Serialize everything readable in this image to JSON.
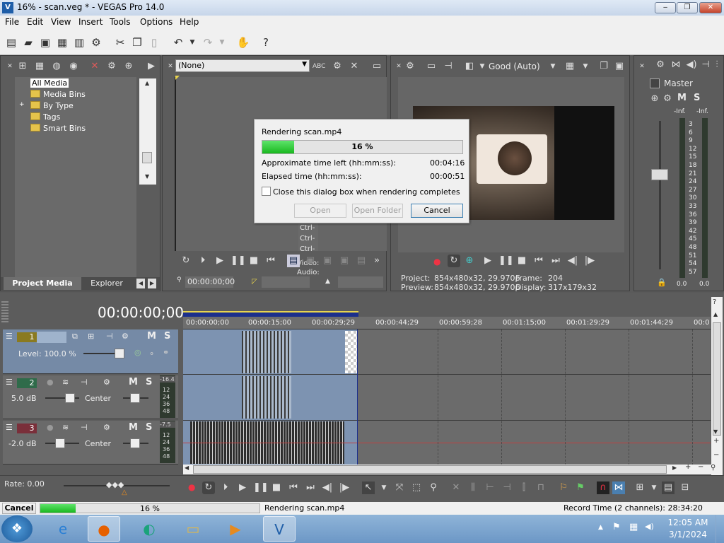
{
  "window": {
    "title": "16% - scan.veg * - VEGAS Pro 14.0",
    "minimize": "‒",
    "maximize": "❐",
    "close": "✕"
  },
  "menu": [
    "File",
    "Edit",
    "View",
    "Insert",
    "Tools",
    "Options",
    "Help"
  ],
  "project_media": {
    "tree": [
      {
        "label": "All Media"
      },
      {
        "label": "Media Bins"
      },
      {
        "label": "By Type",
        "expander": "+"
      },
      {
        "label": "Tags"
      },
      {
        "label": "Smart Bins"
      }
    ],
    "tabs": [
      "Project Media",
      "Explorer"
    ]
  },
  "trimmer": {
    "dropdown": "(None)",
    "side_labels": [
      "Ctrl-",
      "Ctrl-",
      "Ctrl-",
      "Video:",
      "Audio:"
    ],
    "timecode": "00:00:00;00"
  },
  "preview": {
    "quality": "Good (Auto)",
    "project_label": "Project:",
    "project_value": "854x480x32, 29.970p",
    "preview_label": "Preview:",
    "preview_value": "854x480x32, 29.970p",
    "frame_label": "Frame:",
    "frame_value": "204",
    "display_label": "Display:",
    "display_value": "317x179x32"
  },
  "master": {
    "title": "Master",
    "m": "M",
    "s": "S",
    "left_inf": "-Inf.",
    "right_inf": "-Inf.",
    "scale": [
      "3",
      "6",
      "9",
      "12",
      "15",
      "18",
      "21",
      "24",
      "27",
      "30",
      "33",
      "36",
      "39",
      "42",
      "45",
      "48",
      "51",
      "54",
      "57"
    ],
    "left_val": "0.0",
    "right_val": "0.0"
  },
  "render_dialog": {
    "title": "Rendering scan.mp4",
    "progress_percent": 16,
    "progress_text": "16 %",
    "time_left_label": "Approximate time left (hh:mm:ss):",
    "time_left_value": "00:04:16",
    "elapsed_label": "Elapsed time (hh:mm:ss):",
    "elapsed_value": "00:00:51",
    "checkbox_label": "Close this dialog box when rendering completes",
    "open": "Open",
    "open_folder": "Open Folder",
    "cancel": "Cancel"
  },
  "timeline": {
    "timecode": "00:00:00;00",
    "ruler": [
      "00:00:00;00",
      "00:00:15;00",
      "00:00:29;29",
      "00:00:44;29",
      "00:00:59;28",
      "00:01:15;00",
      "00:01:29;29",
      "00:01:44;29",
      "00:0"
    ],
    "tracks": [
      {
        "num": "1",
        "level": "Level: 100.0 %",
        "color": "#8a7a20"
      },
      {
        "num": "2",
        "gain": "5.0 dB",
        "pan": "Center",
        "meter_top": "-16.4",
        "color": "#2f6b4a"
      },
      {
        "num": "3",
        "gain": "-2.0 dB",
        "pan": "Center",
        "meter_top": "-7.5",
        "color": "#7a2f3a"
      }
    ],
    "meter_scale": [
      "12",
      "24",
      "36",
      "48"
    ],
    "rate": "Rate: 0.00",
    "m": "M",
    "s": "S"
  },
  "status": {
    "cancel": "Cancel",
    "progress_percent": 16,
    "progress_text": "16 %",
    "rendering": "Rendering scan.mp4",
    "record_time": "Record Time (2 channels): 28:34:20"
  },
  "taskbar": {
    "time": "12:05 AM",
    "date": "3/1/2024",
    "start_glyph": "❖",
    "tray_up": "▲",
    "tray_flag": "⚑",
    "tray_net": "▦",
    "tray_vol": "◀)",
    "apps": [
      {
        "name": "internet-explorer",
        "glyph": "e",
        "color": "#2a7fd4"
      },
      {
        "name": "firefox",
        "glyph": "●",
        "color": "#e66000"
      },
      {
        "name": "app-green",
        "glyph": "◐",
        "color": "#1aa37a"
      },
      {
        "name": "file-explorer",
        "glyph": "▭",
        "color": "#e0b84a"
      },
      {
        "name": "media-player",
        "glyph": "▶",
        "color": "#e58a1f"
      },
      {
        "name": "vegas",
        "glyph": "V",
        "color": "#1f5ea8"
      }
    ]
  }
}
